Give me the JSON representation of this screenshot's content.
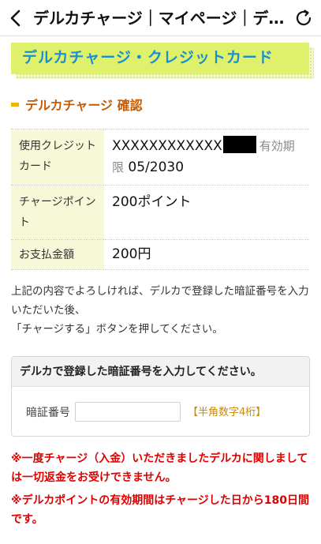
{
  "header": {
    "title": "デルカチャージ｜マイページ｜デ…",
    "back_icon": "chevron-left-icon",
    "reload_icon": "reload-icon"
  },
  "banner": {
    "title": "デルカチャージ・クレジットカード",
    "color": "#1a8fd0",
    "background": "#dff06a"
  },
  "section": {
    "title": "デルカチャージ 確認",
    "accent": "#c85a00"
  },
  "details": {
    "card_label": "使用クレジットカード",
    "card_number": "XXXXXXXXXXXX",
    "expiry_label": "有効期限",
    "expiry_value": "05/2030",
    "points_label": "チャージポイント",
    "points_value": "200ポイント",
    "amount_label": "お支払金額",
    "amount_value": "200円"
  },
  "instruction": {
    "line1": "上記の内容でよろしければ、デルカで登録した暗証番号を入力いただいた後、",
    "line2": "「チャージする」ボタンを押してください。"
  },
  "pin": {
    "header": "デルカで登録した暗証番号を入力してください。",
    "label": "暗証番号",
    "value": "",
    "placeholder": "",
    "hint": "【半角数字4桁】"
  },
  "notices": {
    "notice1": "※一度チャージ（入金）いただきましたデルカに関しましては一切返金をお受けできません。",
    "notice2": "※デルカポイントの有効期間はチャージした日から180日間です。",
    "color": "#e00000"
  }
}
